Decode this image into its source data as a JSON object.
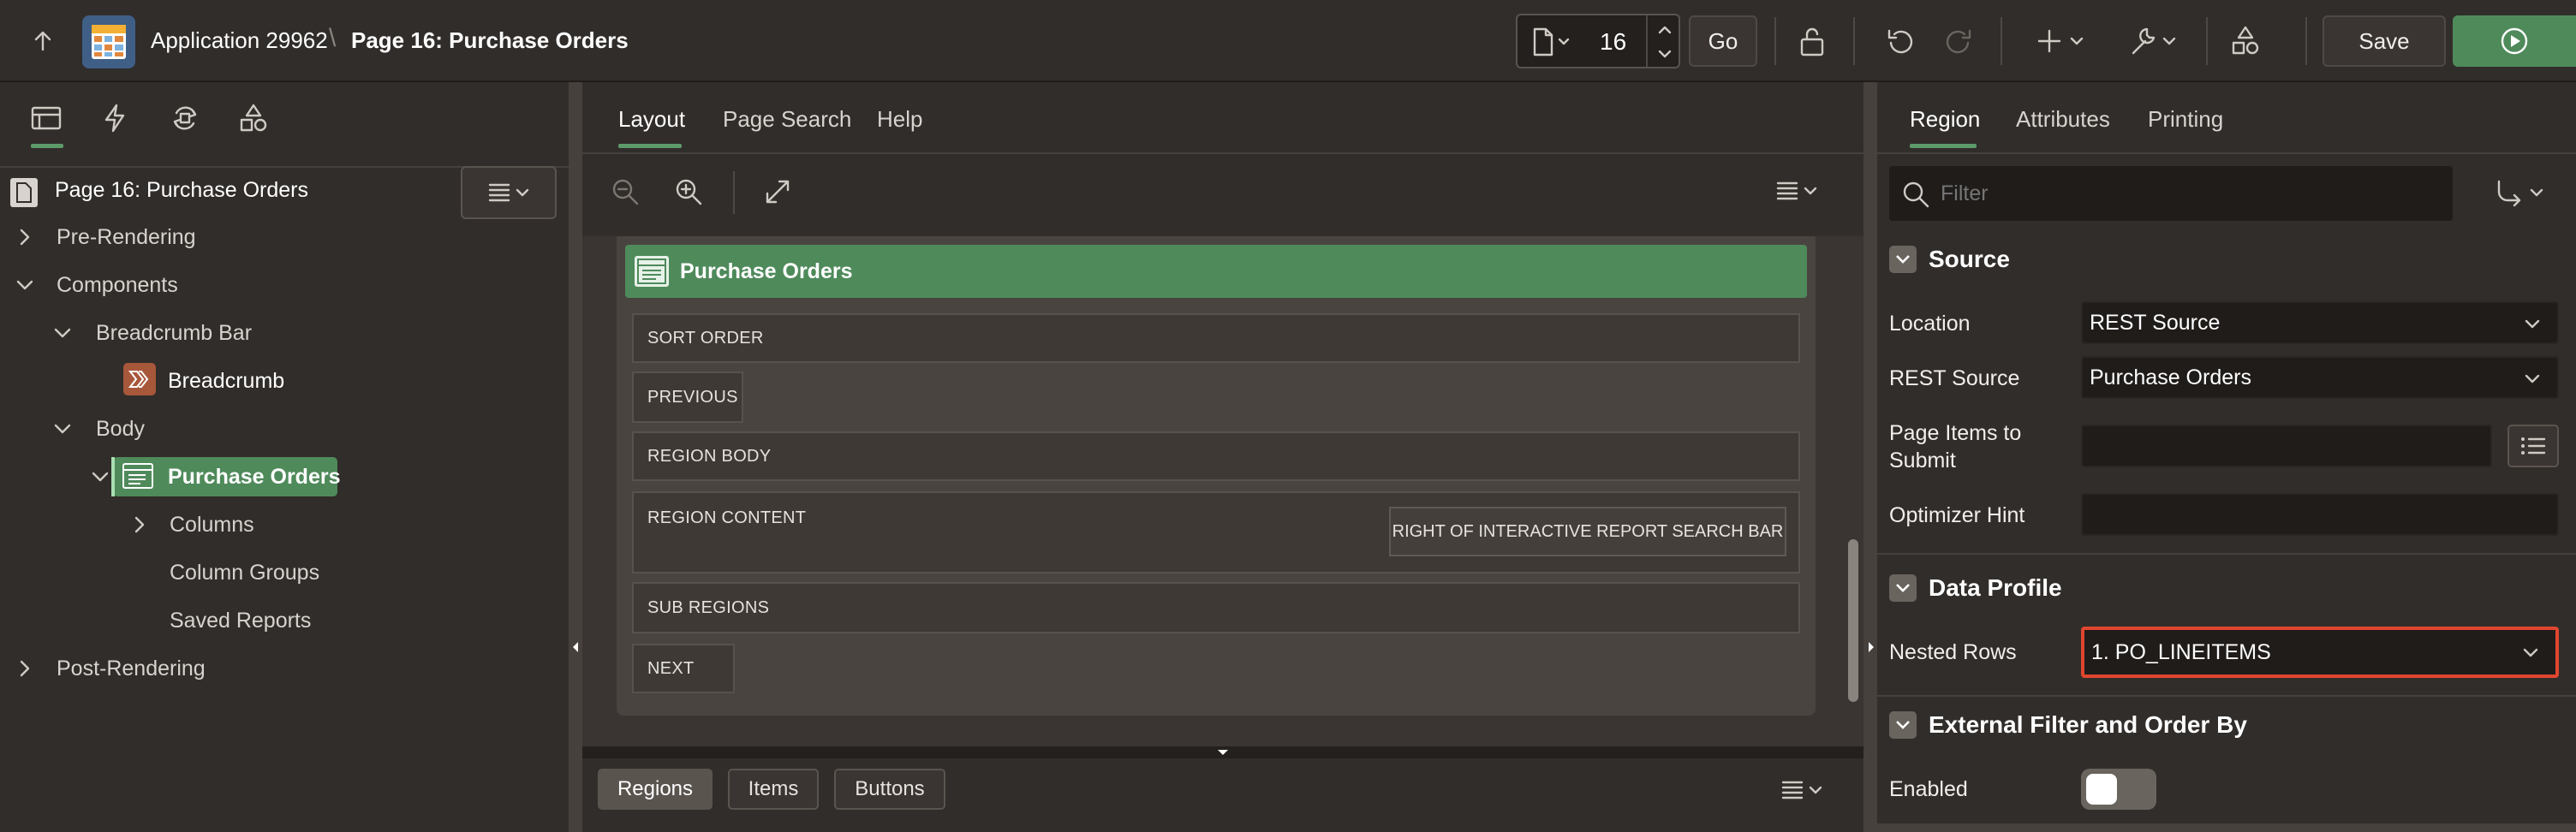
{
  "header": {
    "app_name": "Application 29962",
    "separator": "\\",
    "page_name": "Page 16: Purchase Orders",
    "page_number": "16",
    "go_label": "Go",
    "save_label": "Save",
    "colors": {
      "accent_green": "#4f8a5b",
      "background": "#312d2a"
    }
  },
  "left": {
    "tabs": [
      "rendering-tab",
      "dynamic-actions-tab",
      "processing-tab",
      "shared-components-tab"
    ],
    "page_title": "Page 16: Purchase Orders",
    "tree": {
      "pre_rendering": "Pre-Rendering",
      "components": "Components",
      "breadcrumb_bar": "Breadcrumb Bar",
      "breadcrumb": "Breadcrumb",
      "body": "Body",
      "purchase_orders": "Purchase Orders",
      "columns": "Columns",
      "column_groups": "Column Groups",
      "saved_reports": "Saved Reports",
      "post_rendering": "Post-Rendering"
    }
  },
  "center": {
    "tabs": {
      "layout": "Layout",
      "page_search": "Page Search",
      "help": "Help"
    },
    "region_title": "Purchase Orders",
    "rows": {
      "sort_order": "SORT ORDER",
      "previous": "PREVIOUS",
      "region_body": "REGION BODY",
      "region_content": "REGION CONTENT",
      "right_of_ir": "RIGHT OF INTERACTIVE REPORT SEARCH BAR",
      "sub_regions": "SUB REGIONS",
      "next": "NEXT"
    },
    "gallery_tabs": {
      "regions": "Regions",
      "items": "Items",
      "buttons": "Buttons"
    }
  },
  "right": {
    "tabs": {
      "region": "Region",
      "attributes": "Attributes",
      "printing": "Printing"
    },
    "filter_placeholder": "Filter",
    "source": {
      "heading": "Source",
      "location_label": "Location",
      "location_value": "REST Source",
      "rest_source_label": "REST Source",
      "rest_source_value": "Purchase Orders",
      "page_items_label_1": "Page Items to",
      "page_items_label_2": "Submit",
      "optimizer_hint_label": "Optimizer Hint"
    },
    "data_profile": {
      "heading": "Data Profile",
      "nested_rows_label": "Nested Rows",
      "nested_rows_value": "1. PO_LINEITEMS",
      "highlight_color": "#e0462f"
    },
    "external_filter": {
      "heading": "External Filter and Order By",
      "enabled_label": "Enabled",
      "enabled_value": false
    }
  }
}
